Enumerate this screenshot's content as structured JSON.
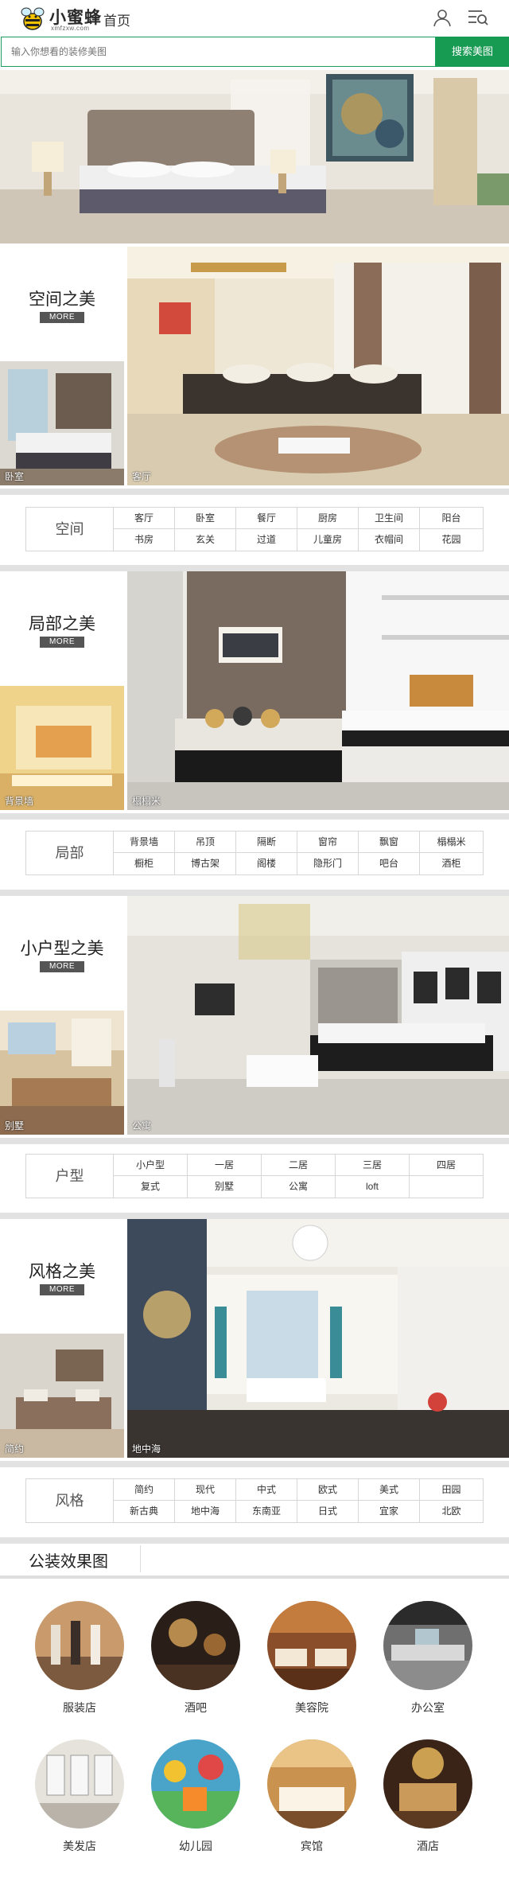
{
  "header": {
    "logo_text": "小蜜蜂",
    "logo_sub": "xmfzxw.com",
    "home": "首页"
  },
  "search": {
    "placeholder": "输入你想看的装修美图",
    "button": "搜索美图"
  },
  "sections": [
    {
      "title": "空间之美",
      "more": "MORE",
      "small_caption": "卧室",
      "big_caption": "客厅",
      "label": "空间",
      "row1": [
        "客厅",
        "卧室",
        "餐厅",
        "厨房",
        "卫生间",
        "阳台"
      ],
      "row2": [
        "书房",
        "玄关",
        "过道",
        "儿童房",
        "衣帽间",
        "花园"
      ]
    },
    {
      "title": "局部之美",
      "more": "MORE",
      "small_caption": "背景墙",
      "big_caption": "榻榻米",
      "label": "局部",
      "row1": [
        "背景墙",
        "吊顶",
        "隔断",
        "窗帘",
        "飘窗",
        "榻榻米"
      ],
      "row2": [
        "橱柜",
        "博古架",
        "阁楼",
        "隐形门",
        "吧台",
        "酒柜"
      ]
    },
    {
      "title": "小户型之美",
      "more": "MORE",
      "small_caption": "别墅",
      "big_caption": "公寓",
      "label": "户型",
      "row1": [
        "小户型",
        "一居",
        "二居",
        "三居",
        "四居"
      ],
      "row2": [
        "复式",
        "别墅",
        "公寓",
        "loft",
        ""
      ]
    },
    {
      "title": "风格之美",
      "more": "MORE",
      "small_caption": "简约",
      "big_caption": "地中海",
      "label": "风格",
      "row1": [
        "简约",
        "现代",
        "中式",
        "欧式",
        "美式",
        "田园"
      ],
      "row2": [
        "新古典",
        "地中海",
        "东南亚",
        "日式",
        "宜家",
        "北欧"
      ]
    }
  ],
  "public": {
    "title": "公装效果图",
    "items": [
      "服装店",
      "酒吧",
      "美容院",
      "办公室",
      "美发店",
      "幼儿园",
      "宾馆",
      "酒店"
    ]
  }
}
